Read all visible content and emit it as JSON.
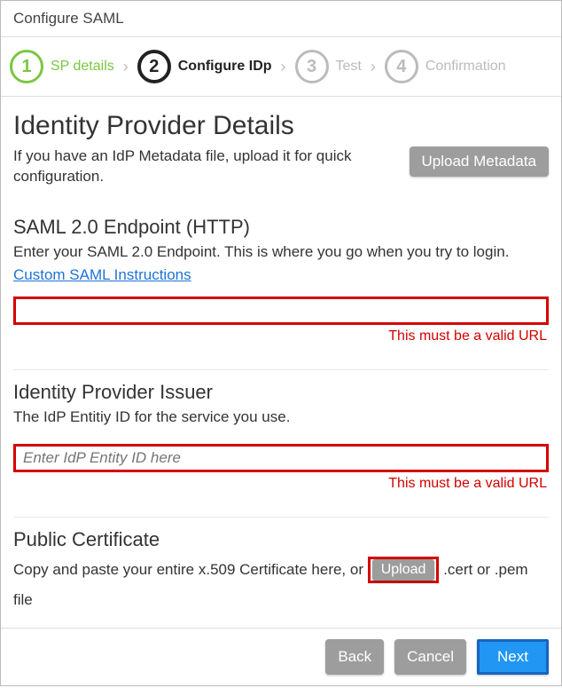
{
  "window": {
    "title": "Configure SAML"
  },
  "stepper": {
    "steps": [
      {
        "num": "1",
        "label": "SP details"
      },
      {
        "num": "2",
        "label": "Configure IDp"
      },
      {
        "num": "3",
        "label": "Test"
      },
      {
        "num": "4",
        "label": "Confirmation"
      }
    ]
  },
  "section": {
    "title": "Identity Provider Details",
    "metadata_desc": "If you have an IdP Metadata file, upload it for quick configuration.",
    "upload_metadata_label": "Upload Metadata"
  },
  "endpoint": {
    "heading": "SAML 2.0 Endpoint (HTTP)",
    "desc": "Enter your SAML 2.0 Endpoint. This is where you go when you try to login.",
    "link_text": "Custom SAML Instructions",
    "value": "",
    "error": "This must be a valid URL"
  },
  "issuer": {
    "heading": "Identity Provider Issuer",
    "desc": "The IdP Entitiy ID for the service you use.",
    "placeholder": "Enter IdP Entity ID here",
    "value": "",
    "error": "This must be a valid URL"
  },
  "cert": {
    "heading": "Public Certificate",
    "desc_prefix": "Copy and paste your entire x.509 Certificate here, or ",
    "upload_label": "Upload",
    "desc_suffix": " .cert or .pem file"
  },
  "footer": {
    "back": "Back",
    "cancel": "Cancel",
    "next": "Next"
  }
}
